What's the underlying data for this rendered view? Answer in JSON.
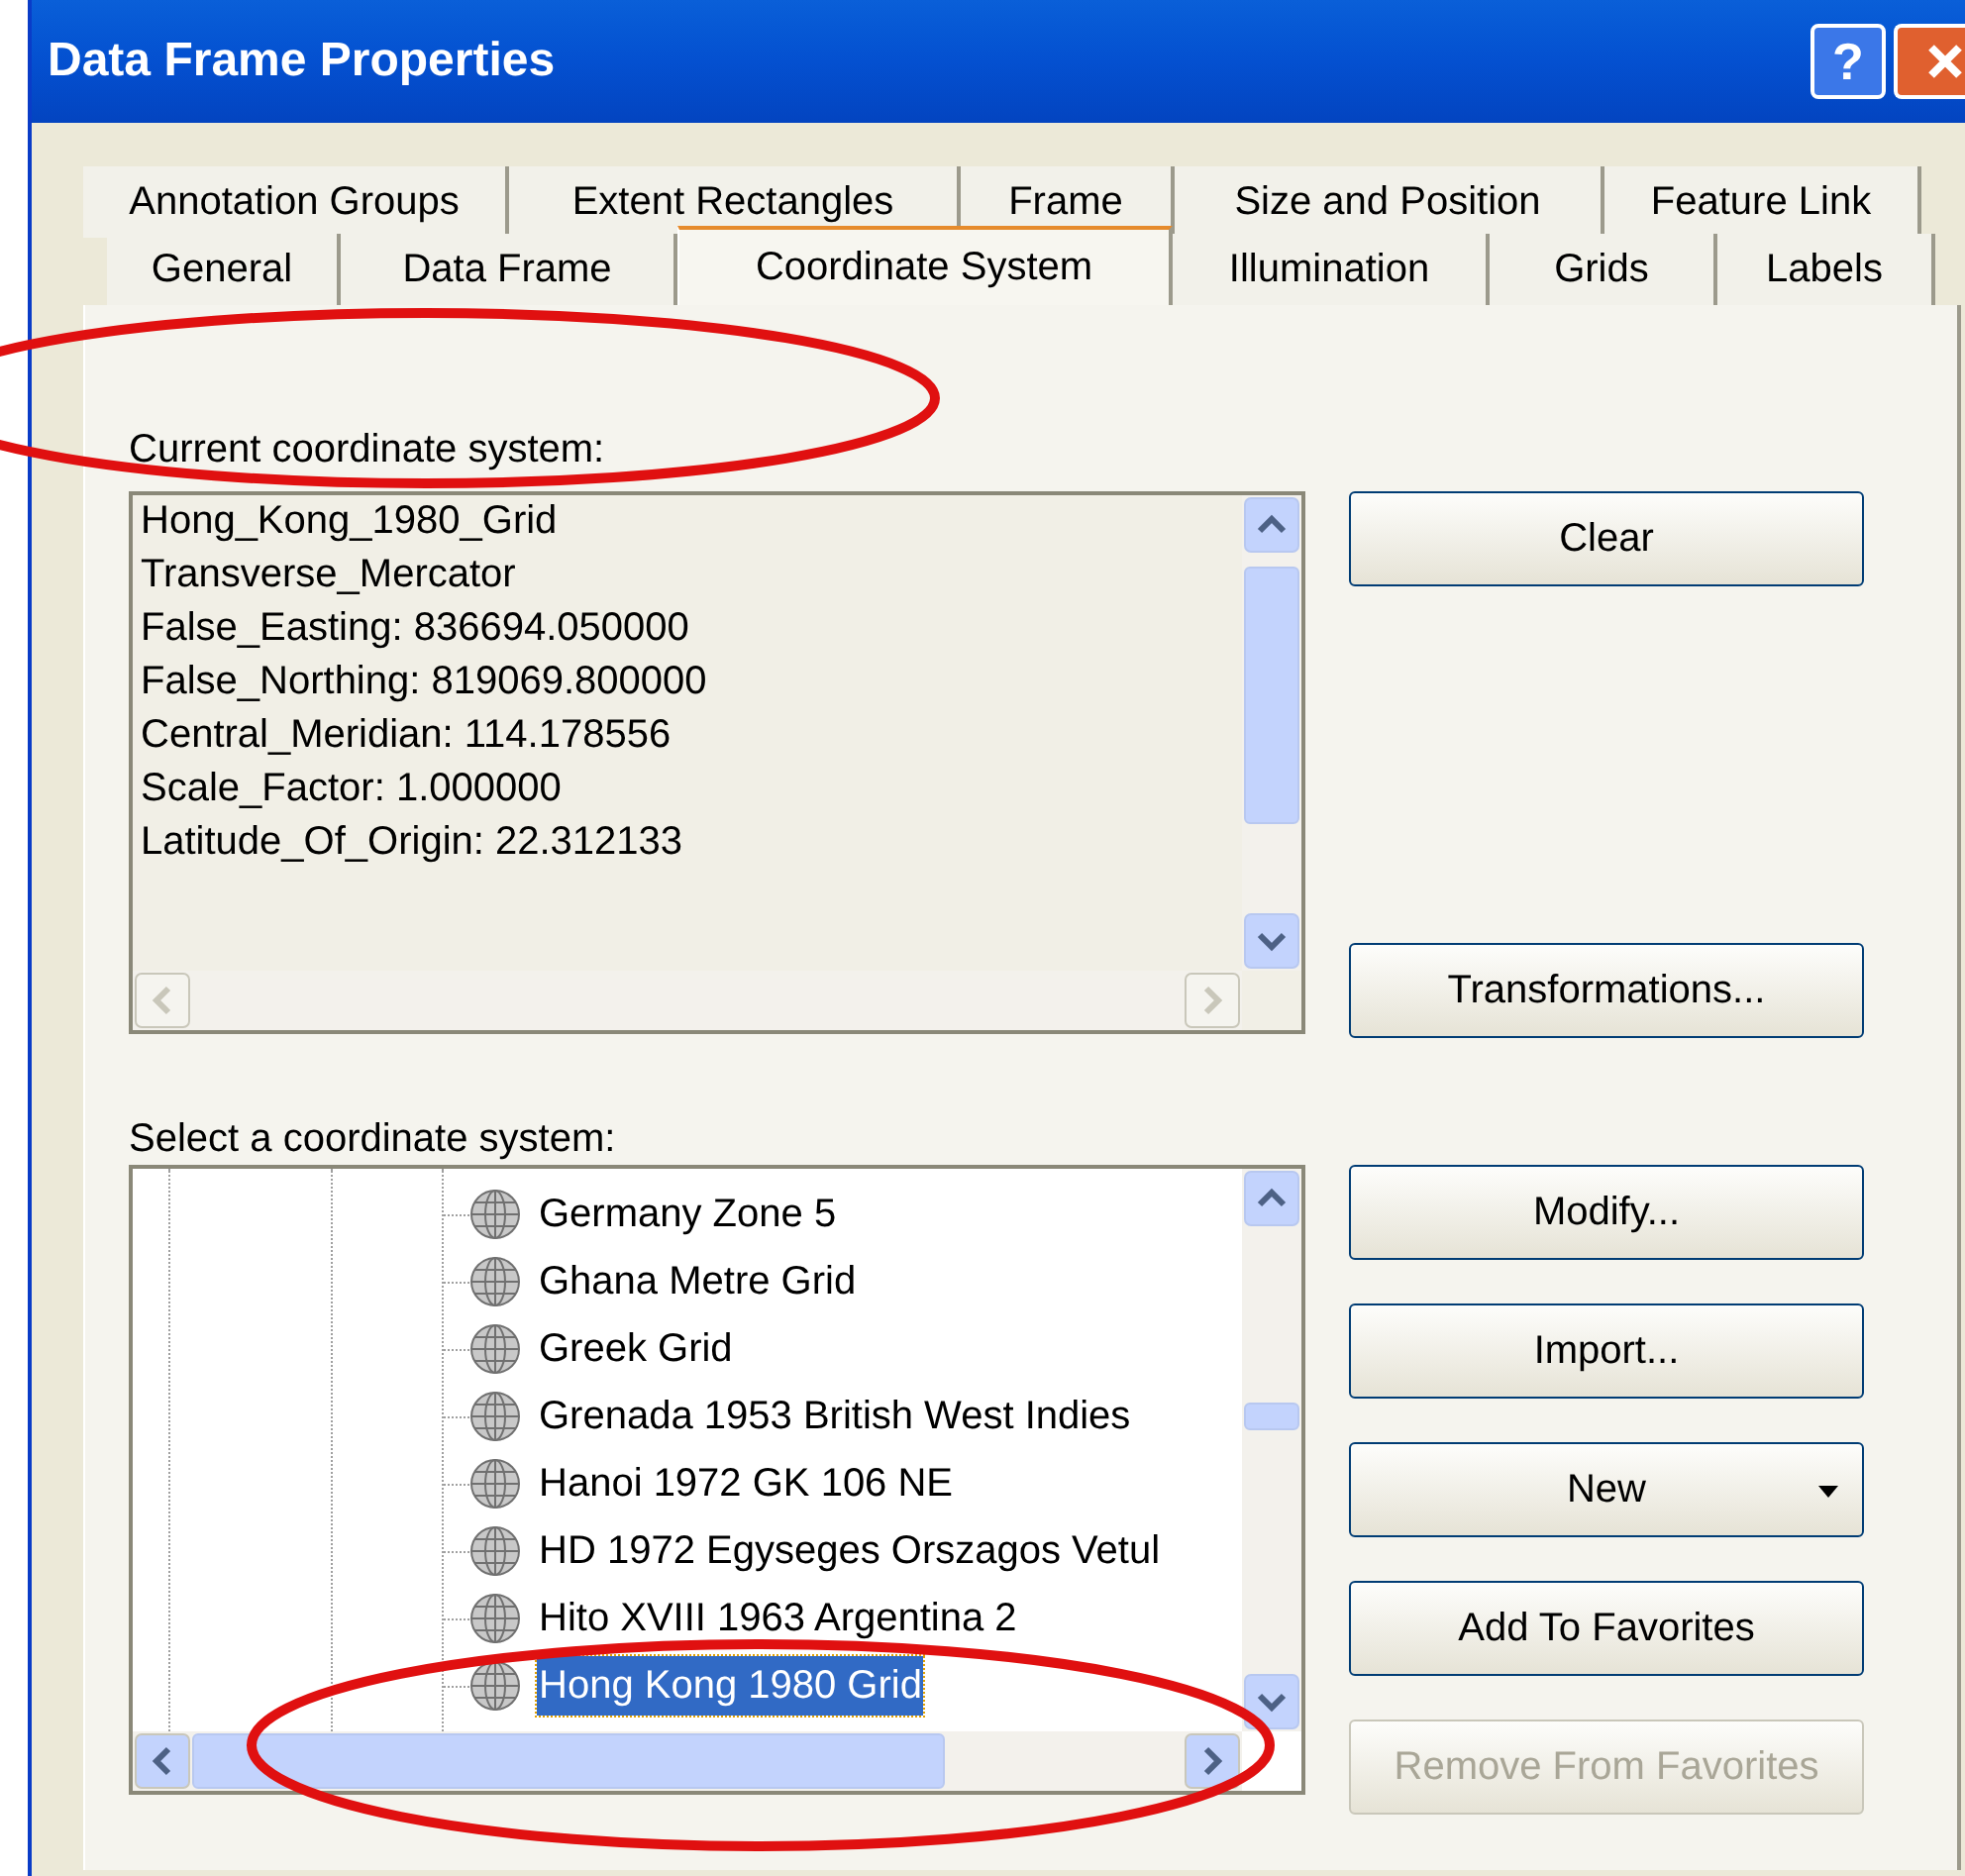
{
  "window": {
    "title": "Data Frame Properties",
    "help_button": "?"
  },
  "tab_rows": [
    {
      "tabs": [
        {
          "label": "Annotation Groups",
          "selected": false
        },
        {
          "label": "Extent Rectangles",
          "selected": false
        },
        {
          "label": "Frame",
          "selected": false
        },
        {
          "label": "Size and Position",
          "selected": false
        },
        {
          "label": "Feature Link",
          "selected": false
        }
      ]
    },
    {
      "tabs": [
        {
          "label": "General",
          "selected": false
        },
        {
          "label": "Data Frame",
          "selected": false
        },
        {
          "label": "Coordinate System",
          "selected": true
        },
        {
          "label": "Illumination",
          "selected": false
        },
        {
          "label": "Grids",
          "selected": false
        },
        {
          "label": "Labels",
          "selected": false
        }
      ]
    }
  ],
  "current_system": {
    "label": "Current coordinate system:",
    "lines": [
      "Hong_Kong_1980_Grid",
      "Transverse_Mercator",
      "False_Easting: 836694.050000",
      "False_Northing: 819069.800000",
      "Central_Meridian: 114.178556",
      "Scale_Factor: 1.000000",
      "Latitude_Of_Origin: 22.312133"
    ],
    "buttons": [
      {
        "label": "Clear",
        "disabled": false
      },
      {
        "label": "Transformations...",
        "disabled": false
      }
    ]
  },
  "select_system": {
    "label": "Select a coordinate system:",
    "items": [
      {
        "label": "Germany Zone 5",
        "selected": false
      },
      {
        "label": "Ghana Metre Grid",
        "selected": false
      },
      {
        "label": "Greek Grid",
        "selected": false
      },
      {
        "label": "Grenada 1953 British West Indies",
        "selected": false
      },
      {
        "label": "Hanoi 1972 GK 106 NE",
        "selected": false
      },
      {
        "label": "HD 1972 Egyseges Orszagos Vetul",
        "selected": false
      },
      {
        "label": "Hito XVIII 1963 Argentina 2",
        "selected": false
      },
      {
        "label": "Hong Kong 1980 Grid",
        "selected": true
      }
    ],
    "buttons": [
      {
        "label": "Modify...",
        "kind": "plain",
        "disabled": false
      },
      {
        "label": "Import...",
        "kind": "plain",
        "disabled": false
      },
      {
        "label": "New",
        "kind": "dropdown",
        "disabled": false
      },
      {
        "label": "Add To Favorites",
        "kind": "plain",
        "disabled": false
      },
      {
        "label": "Remove From Favorites",
        "kind": "plain",
        "disabled": true
      }
    ]
  }
}
